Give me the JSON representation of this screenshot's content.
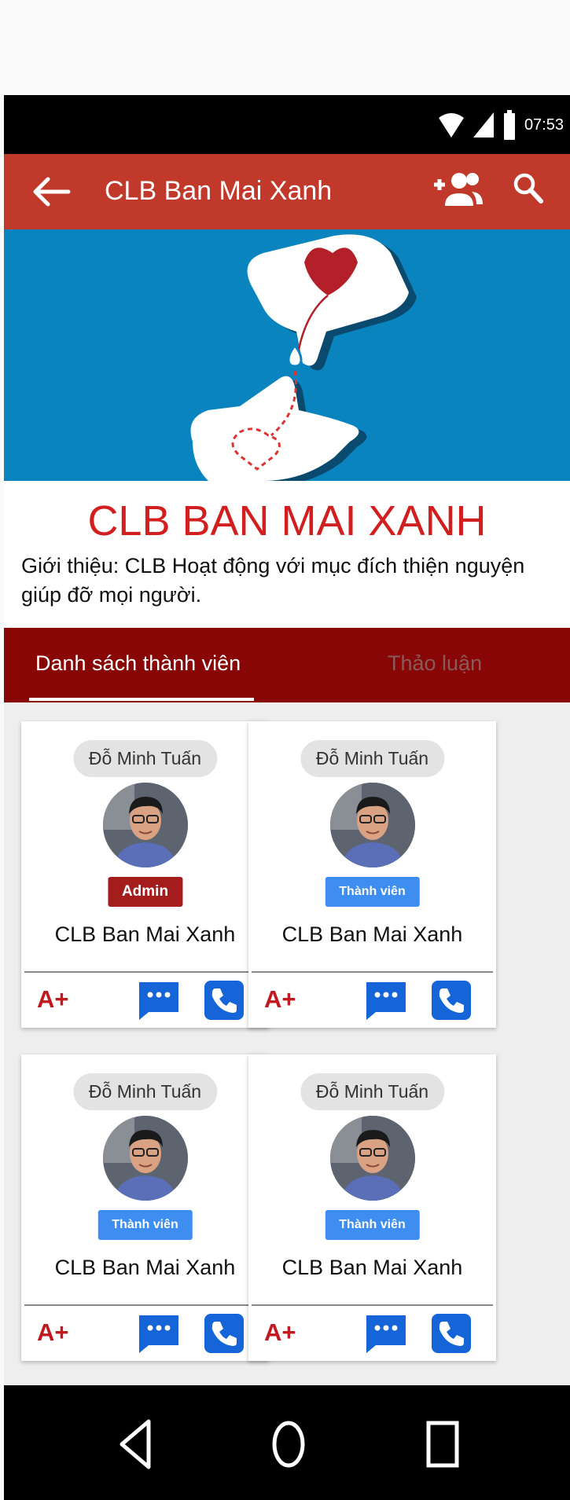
{
  "status_bar": {
    "time": "07:53"
  },
  "appbar": {
    "title": "CLB Ban Mai Xanh"
  },
  "club": {
    "name": "CLB BAN MAI XANH",
    "intro": "Giới thiệu: CLB Hoạt động với mục đích thiện nguyện giúp đỡ mọi người."
  },
  "tabs": {
    "members": "Danh sách thành viên",
    "discussion": "Thảo luận"
  },
  "members": [
    {
      "name": "Đỗ Minh Tuấn",
      "role": "Admin",
      "club": "CLB Ban Mai Xanh",
      "blood": "A+"
    },
    {
      "name": "Đỗ Minh Tuấn",
      "role": "Thành viên",
      "club": "CLB Ban Mai Xanh",
      "blood": "A+"
    },
    {
      "name": "Đỗ Minh Tuấn",
      "role": "Thành viên",
      "club": "CLB Ban Mai Xanh",
      "blood": "A+"
    },
    {
      "name": "Đỗ Minh Tuấn",
      "role": "Thành viên",
      "club": "CLB Ban Mai Xanh",
      "blood": "A+"
    }
  ],
  "colors": {
    "appbar": "#c0392b",
    "tabs": "#880606",
    "accent_red": "#d11f1f",
    "call": "#1565d8",
    "member_badge": "#3d8ef0"
  },
  "icons": {
    "back": "arrow-left-icon",
    "add_user": "person-add-icon",
    "search": "search-icon",
    "chat": "chat-bubble-icon",
    "call": "phone-icon",
    "nav_back": "triangle-back-icon",
    "nav_home": "circle-home-icon",
    "nav_recent": "square-recent-icon"
  }
}
